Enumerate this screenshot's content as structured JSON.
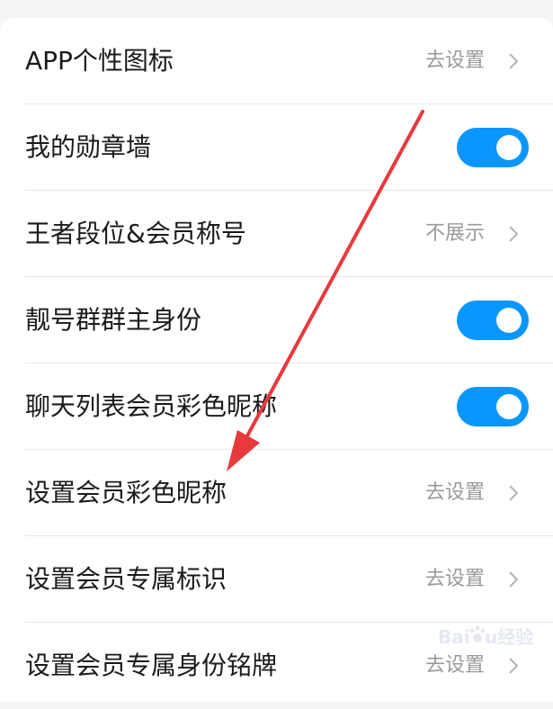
{
  "settings": {
    "rows": [
      {
        "label": "APP个性图标",
        "value": "去设置",
        "control": "chevron"
      },
      {
        "label": "我的勋章墙",
        "value": "",
        "control": "toggle",
        "on": true
      },
      {
        "label": "王者段位&会员称号",
        "value": "不展示",
        "control": "chevron"
      },
      {
        "label": "靓号群群主身份",
        "value": "",
        "control": "toggle",
        "on": true
      },
      {
        "label": "聊天列表会员彩色昵称",
        "value": "",
        "control": "toggle",
        "on": true
      },
      {
        "label": "设置会员彩色昵称",
        "value": "去设置",
        "control": "chevron"
      },
      {
        "label": "设置会员专属标识",
        "value": "去设置",
        "control": "chevron"
      },
      {
        "label": "设置会员专属身份铭牌",
        "value": "去设置",
        "control": "chevron"
      }
    ]
  },
  "colors": {
    "toggle_on": "#0a96ff",
    "annotation_arrow": "#e8393c"
  },
  "watermark": {
    "text": "Baidu经验"
  }
}
